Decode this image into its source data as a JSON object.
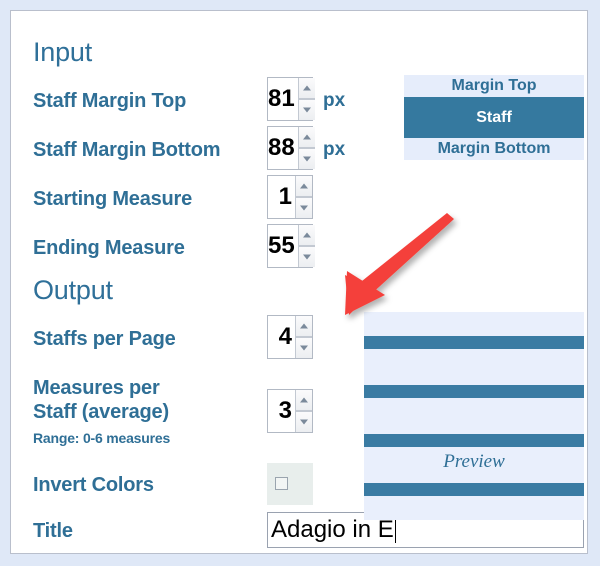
{
  "sections": {
    "input_heading": "Input",
    "output_heading": "Output"
  },
  "fields": {
    "staff_margin_top": {
      "label": "Staff Margin Top",
      "value": "81",
      "unit": "px"
    },
    "staff_margin_bottom": {
      "label": "Staff Margin Bottom",
      "value": "88",
      "unit": "px"
    },
    "starting_measure": {
      "label": "Starting Measure",
      "value": "1"
    },
    "ending_measure": {
      "label": "Ending Measure",
      "value": "55"
    },
    "staffs_per_page": {
      "label": "Staffs per Page",
      "value": "4"
    },
    "measures_per_staff": {
      "label_line1": "Measures per",
      "label_line2": "Staff (average)",
      "hint": "Range: 0-6 measures",
      "value": "3"
    },
    "invert_colors": {
      "label": "Invert Colors",
      "checked": false
    },
    "title": {
      "label": "Title",
      "value": "Adagio in E"
    }
  },
  "staff_diagram": {
    "margin_top_label": "Margin Top",
    "staff_label": "Staff",
    "margin_bottom_label": "Margin Bottom"
  },
  "preview": {
    "caption": "Preview",
    "staff_count": 4
  },
  "annotation": {
    "arrow": "red-arrow-pointing-to-staffs-per-page"
  },
  "colors": {
    "accent_blue": "#2f6f96",
    "staff_bar": "#3a7ba3",
    "margin_band": "#e6edfb",
    "preview_bg": "#e9effc",
    "arrow_red": "#f4403a",
    "frame_bg": "#dfe8f7"
  }
}
